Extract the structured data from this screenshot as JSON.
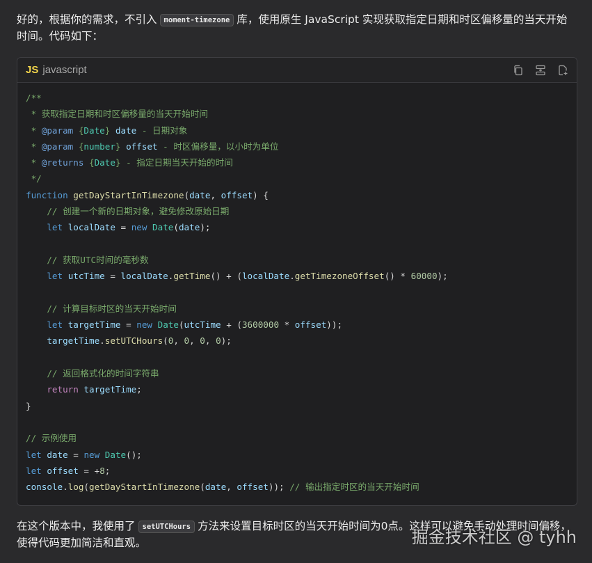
{
  "intro": {
    "before": "好的，根据你的需求，不引入",
    "code": "moment-timezone",
    "after": "库，使用原生 JavaScript 实现获取指定日期和时区偏移量的当天开始时间。代码如下："
  },
  "codeblock": {
    "lang_icon": "JS",
    "lang_label": "javascript",
    "icons": [
      "copy-icon",
      "wrap-icon",
      "insert-file-icon"
    ],
    "lines": [
      [
        [
          "c-cm",
          "/**"
        ]
      ],
      [
        [
          "c-cm",
          " * 获取指定日期和时区偏移量的当天开始时间"
        ]
      ],
      [
        [
          "c-cm",
          " * "
        ],
        [
          "c-tag",
          "@param"
        ],
        [
          "c-cm",
          " {"
        ],
        [
          "c-type",
          "Date"
        ],
        [
          "c-cm",
          "} "
        ],
        [
          "c-var",
          "date"
        ],
        [
          "c-cm",
          " - 日期对象"
        ]
      ],
      [
        [
          "c-cm",
          " * "
        ],
        [
          "c-tag",
          "@param"
        ],
        [
          "c-cm",
          " {"
        ],
        [
          "c-type",
          "number"
        ],
        [
          "c-cm",
          "} "
        ],
        [
          "c-var",
          "offset"
        ],
        [
          "c-cm",
          " - 时区偏移量，以小时为单位"
        ]
      ],
      [
        [
          "c-cm",
          " * "
        ],
        [
          "c-tag",
          "@returns"
        ],
        [
          "c-cm",
          " {"
        ],
        [
          "c-type",
          "Date"
        ],
        [
          "c-cm",
          "} - 指定日期当天开始的时间"
        ]
      ],
      [
        [
          "c-cm",
          " */"
        ]
      ],
      [
        [
          "c-kwb",
          "function"
        ],
        [
          "",
          " "
        ],
        [
          "c-fn",
          "getDayStartInTimezone"
        ],
        [
          "",
          "("
        ],
        [
          "c-var",
          "date"
        ],
        [
          "",
          ", "
        ],
        [
          "c-var",
          "offset"
        ],
        [
          "",
          ") {"
        ]
      ],
      [
        [
          "",
          "    "
        ],
        [
          "c-cm",
          "// 创建一个新的日期对象，避免修改原始日期"
        ]
      ],
      [
        [
          "",
          "    "
        ],
        [
          "c-kwb",
          "let"
        ],
        [
          "",
          " "
        ],
        [
          "c-var",
          "localDate"
        ],
        [
          "",
          " = "
        ],
        [
          "c-kwb",
          "new"
        ],
        [
          "",
          " "
        ],
        [
          "c-cls",
          "Date"
        ],
        [
          "",
          "("
        ],
        [
          "c-var",
          "date"
        ],
        [
          "",
          ");"
        ]
      ],
      [
        [
          "",
          ""
        ]
      ],
      [
        [
          "",
          "    "
        ],
        [
          "c-cm",
          "// 获取UTC时间的毫秒数"
        ]
      ],
      [
        [
          "",
          "    "
        ],
        [
          "c-kwb",
          "let"
        ],
        [
          "",
          " "
        ],
        [
          "c-var",
          "utcTime"
        ],
        [
          "",
          " = "
        ],
        [
          "c-var",
          "localDate"
        ],
        [
          "",
          "."
        ],
        [
          "c-fn",
          "getTime"
        ],
        [
          "",
          "() + ("
        ],
        [
          "c-var",
          "localDate"
        ],
        [
          "",
          "."
        ],
        [
          "c-fn",
          "getTimezoneOffset"
        ],
        [
          "",
          "() * "
        ],
        [
          "c-num",
          "60000"
        ],
        [
          "",
          ");"
        ]
      ],
      [
        [
          "",
          ""
        ]
      ],
      [
        [
          "",
          "    "
        ],
        [
          "c-cm",
          "// 计算目标时区的当天开始时间"
        ]
      ],
      [
        [
          "",
          "    "
        ],
        [
          "c-kwb",
          "let"
        ],
        [
          "",
          " "
        ],
        [
          "c-var",
          "targetTime"
        ],
        [
          "",
          " = "
        ],
        [
          "c-kwb",
          "new"
        ],
        [
          "",
          " "
        ],
        [
          "c-cls",
          "Date"
        ],
        [
          "",
          "("
        ],
        [
          "c-var",
          "utcTime"
        ],
        [
          "",
          " + ("
        ],
        [
          "c-num",
          "3600000"
        ],
        [
          "",
          " * "
        ],
        [
          "c-var",
          "offset"
        ],
        [
          "",
          "));"
        ]
      ],
      [
        [
          "",
          "    "
        ],
        [
          "c-var",
          "targetTime"
        ],
        [
          "",
          "."
        ],
        [
          "c-fn",
          "setUTCHours"
        ],
        [
          "",
          "("
        ],
        [
          "c-num",
          "0"
        ],
        [
          "",
          ", "
        ],
        [
          "c-num",
          "0"
        ],
        [
          "",
          ", "
        ],
        [
          "c-num",
          "0"
        ],
        [
          "",
          ", "
        ],
        [
          "c-num",
          "0"
        ],
        [
          "",
          ");"
        ]
      ],
      [
        [
          "",
          ""
        ]
      ],
      [
        [
          "",
          "    "
        ],
        [
          "c-cm",
          "// 返回格式化的时间字符串"
        ]
      ],
      [
        [
          "",
          "    "
        ],
        [
          "c-kw",
          "return"
        ],
        [
          "",
          " "
        ],
        [
          "c-var",
          "targetTime"
        ],
        [
          "",
          ";"
        ]
      ],
      [
        [
          "",
          "}"
        ]
      ],
      [
        [
          "",
          ""
        ]
      ],
      [
        [
          "c-cm",
          "// 示例使用"
        ]
      ],
      [
        [
          "c-kwb",
          "let"
        ],
        [
          "",
          " "
        ],
        [
          "c-var",
          "date"
        ],
        [
          "",
          " = "
        ],
        [
          "c-kwb",
          "new"
        ],
        [
          "",
          " "
        ],
        [
          "c-cls",
          "Date"
        ],
        [
          "",
          "();"
        ]
      ],
      [
        [
          "c-kwb",
          "let"
        ],
        [
          "",
          " "
        ],
        [
          "c-var",
          "offset"
        ],
        [
          "",
          " = +"
        ],
        [
          "c-num",
          "8"
        ],
        [
          "",
          ";"
        ]
      ],
      [
        [
          "c-var",
          "console"
        ],
        [
          "",
          "."
        ],
        [
          "c-fn",
          "log"
        ],
        [
          "",
          "("
        ],
        [
          "c-fn",
          "getDayStartInTimezone"
        ],
        [
          "",
          "("
        ],
        [
          "c-var",
          "date"
        ],
        [
          "",
          ", "
        ],
        [
          "c-var",
          "offset"
        ],
        [
          "",
          "));"
        ],
        [
          "",
          " "
        ],
        [
          "c-cm",
          "// 输出指定时区的当天开始时间"
        ]
      ]
    ]
  },
  "outro": {
    "before": "在这个版本中，我使用了",
    "code": "setUTCHours",
    "after": "方法来设置目标时区的当天开始时间为0点。这样可以避免手动处理时间偏移，使得代码更加简洁和直观。"
  },
  "watermark": "掘金技术社区 @ tyhh"
}
